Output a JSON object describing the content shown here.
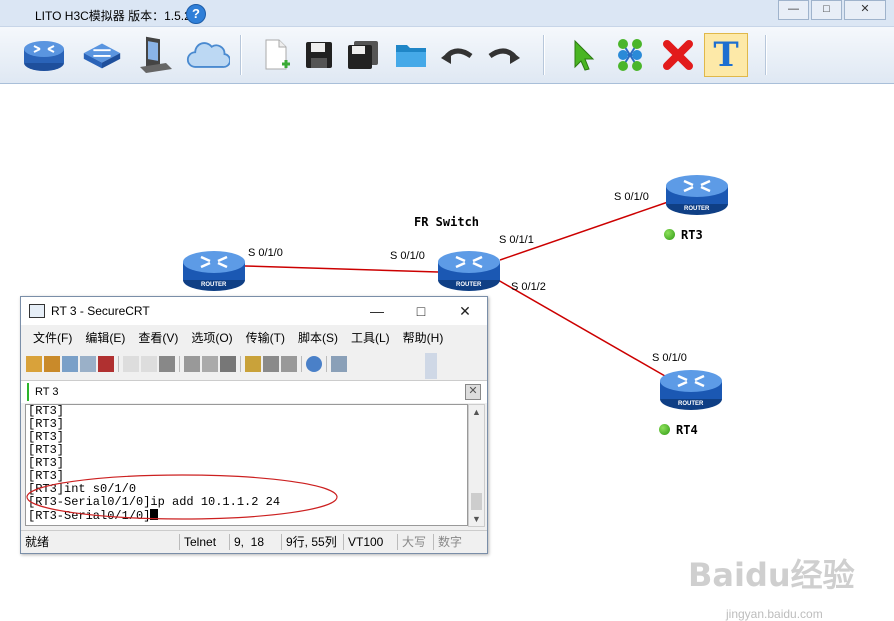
{
  "app": {
    "title": "LITO H3C模拟器 版本：1.5.2",
    "help_icon": "question-icon"
  },
  "window_buttons": [
    "—",
    "□",
    "✕"
  ],
  "toolbar": {
    "icons": [
      "router-icon",
      "switch-icon",
      "pc-icon",
      "cloud-icon",
      "new-file-icon",
      "save-icon",
      "save-as-icon",
      "open-folder-icon",
      "undo-icon",
      "redo-icon",
      "pointer-icon",
      "connect-icon",
      "delete-icon",
      "text-icon"
    ]
  },
  "topology": {
    "router_label": "ROUTER",
    "fr_switch": {
      "name": "FR Switch"
    },
    "nodes": [
      {
        "name": "RT3",
        "status": "green"
      },
      {
        "name": "RT4",
        "status": "green"
      }
    ],
    "ports": {
      "rt_left": "S 0/1/0",
      "fr_left": "S 0/1/0",
      "fr_up": "S 0/1/1",
      "fr_down": "S 0/1/2",
      "rt3": "S 0/1/0",
      "rt4": "S 0/1/0"
    },
    "link_color": "#cc0000"
  },
  "crt": {
    "title": "RT 3 - SecureCRT",
    "buttons": [
      "—",
      "□",
      "✕"
    ],
    "menu": [
      "文件(F)",
      "编辑(E)",
      "查看(V)",
      "选项(O)",
      "传输(T)",
      "脚本(S)",
      "工具(L)",
      "帮助(H)"
    ],
    "tab": "RT 3",
    "terminal_lines": [
      "[RT3]",
      "[RT3]",
      "[RT3]",
      "[RT3]",
      "[RT3]",
      "[RT3]",
      "[RT3]int s0/1/0",
      "[RT3-Serial0/1/0]ip add 10.1.1.2 24",
      "[RT3-Serial0/1/0]"
    ],
    "status": {
      "ready": "就绪",
      "protocol": "Telnet",
      "cursor": "9,  18",
      "pos": "9行, 55列",
      "emulation": "VT100",
      "caps": "大写",
      "num": "数字"
    }
  },
  "watermark": {
    "logo": "Baidu经验",
    "url": "jingyan.baidu.com"
  }
}
